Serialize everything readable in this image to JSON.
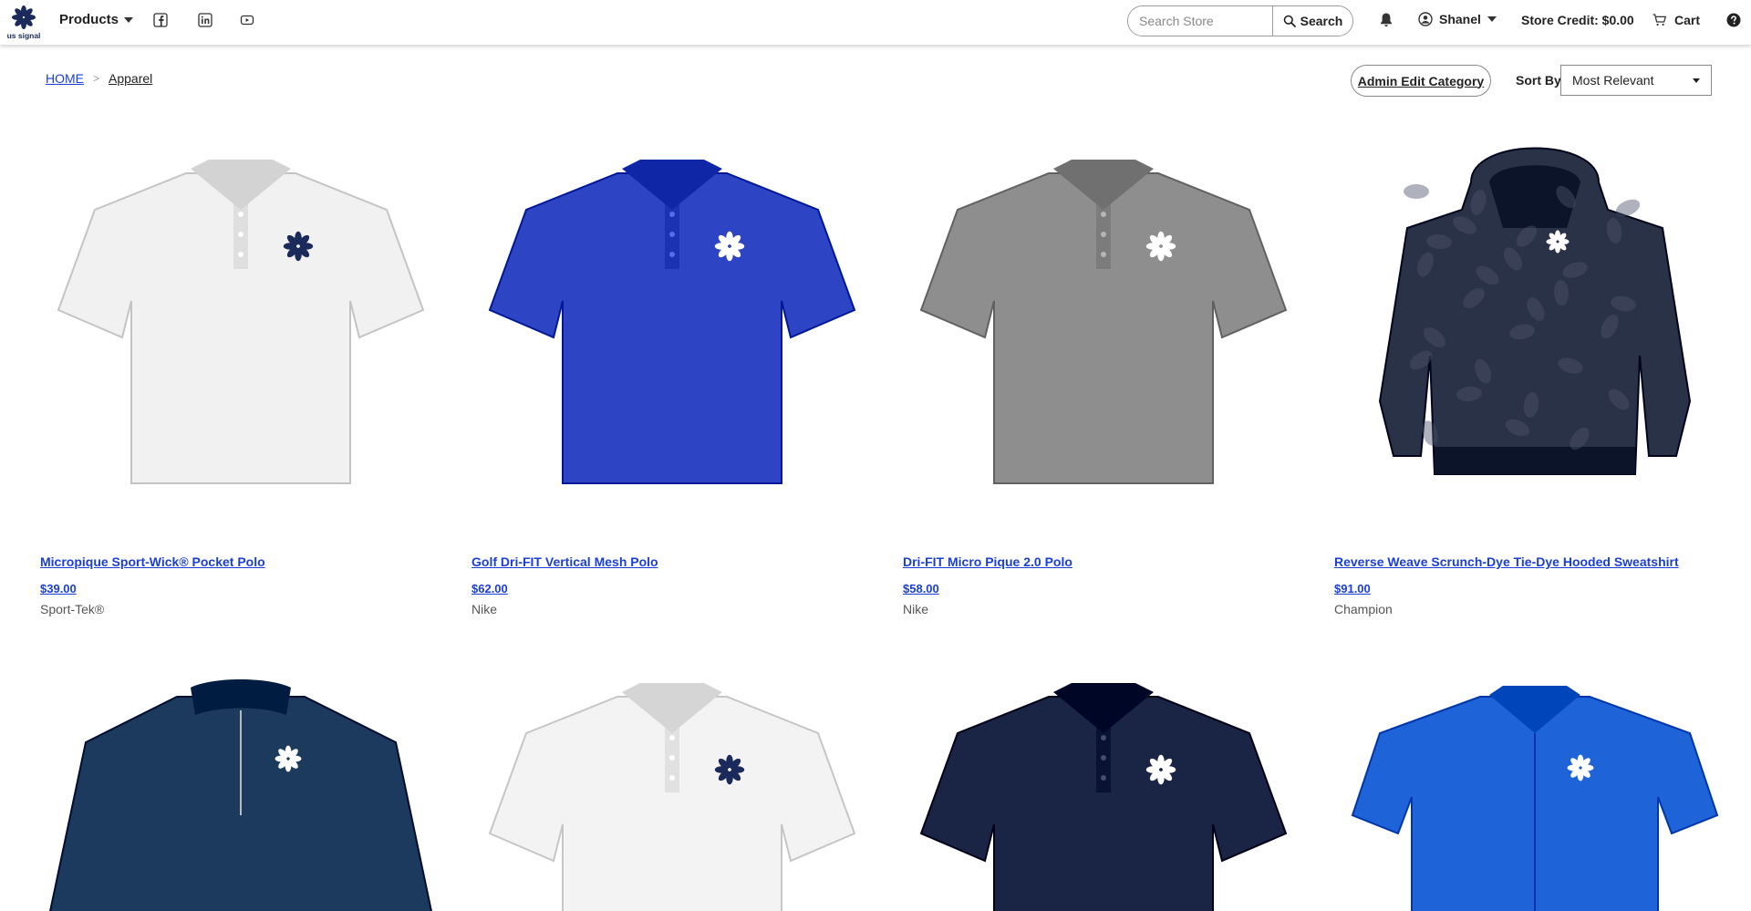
{
  "header": {
    "brand_logo_text": "us signal",
    "products_label": "Products",
    "social_icons": [
      "facebook-icon",
      "linkedin-icon",
      "youtube-icon"
    ],
    "search": {
      "placeholder": "Search Store",
      "value": "",
      "button_label": "Search"
    },
    "user_name": "Shanel",
    "store_credit": "Store Credit: $0.00",
    "cart_label": "Cart"
  },
  "breadcrumb": {
    "home": "HOME",
    "separator": ">",
    "current": "Apparel"
  },
  "toolbar": {
    "admin_button": "Admin Edit Category",
    "sort_label": "Sort By",
    "sort_value": "Most Relevant"
  },
  "colors": {
    "link": "#1a3fd6",
    "brand_navy": "#1b2a5b"
  },
  "products": [
    {
      "title": "Micropique Sport-Wick® Pocket Polo",
      "price": "$39.00",
      "brand": "Sport-Tek®",
      "garment": "polo",
      "color": "#f1f1f1",
      "logo": "#1b2a5b"
    },
    {
      "title": "Golf Dri-FIT Vertical Mesh Polo",
      "price": "$62.00",
      "brand": "Nike",
      "garment": "polo",
      "color": "#2d45c4",
      "logo": "#ffffff"
    },
    {
      "title": "Dri-FIT Micro Pique 2.0 Polo",
      "price": "$58.00",
      "brand": "Nike",
      "garment": "polo",
      "color": "#8e8e8e",
      "logo": "#ffffff"
    },
    {
      "title": "Reverse Weave Scrunch-Dye Tie-Dye Hooded Sweatshirt",
      "price": "$91.00",
      "brand": "Champion",
      "garment": "hoodie",
      "color": "#2a3248",
      "logo": "#ffffff"
    },
    {
      "title": "",
      "price": "",
      "brand": "",
      "garment": "quarterzip",
      "color": "#1c3a5e",
      "logo": "#ffffff"
    },
    {
      "title": "",
      "price": "",
      "brand": "",
      "garment": "polo",
      "color": "#f3f3f3",
      "logo": "#1b2a5b"
    },
    {
      "title": "",
      "price": "",
      "brand": "",
      "garment": "polo",
      "color": "#1a2444",
      "logo": "#ffffff"
    },
    {
      "title": "",
      "price": "",
      "brand": "",
      "garment": "shirt",
      "color": "#1f63d8",
      "logo": "#ffffff"
    }
  ]
}
